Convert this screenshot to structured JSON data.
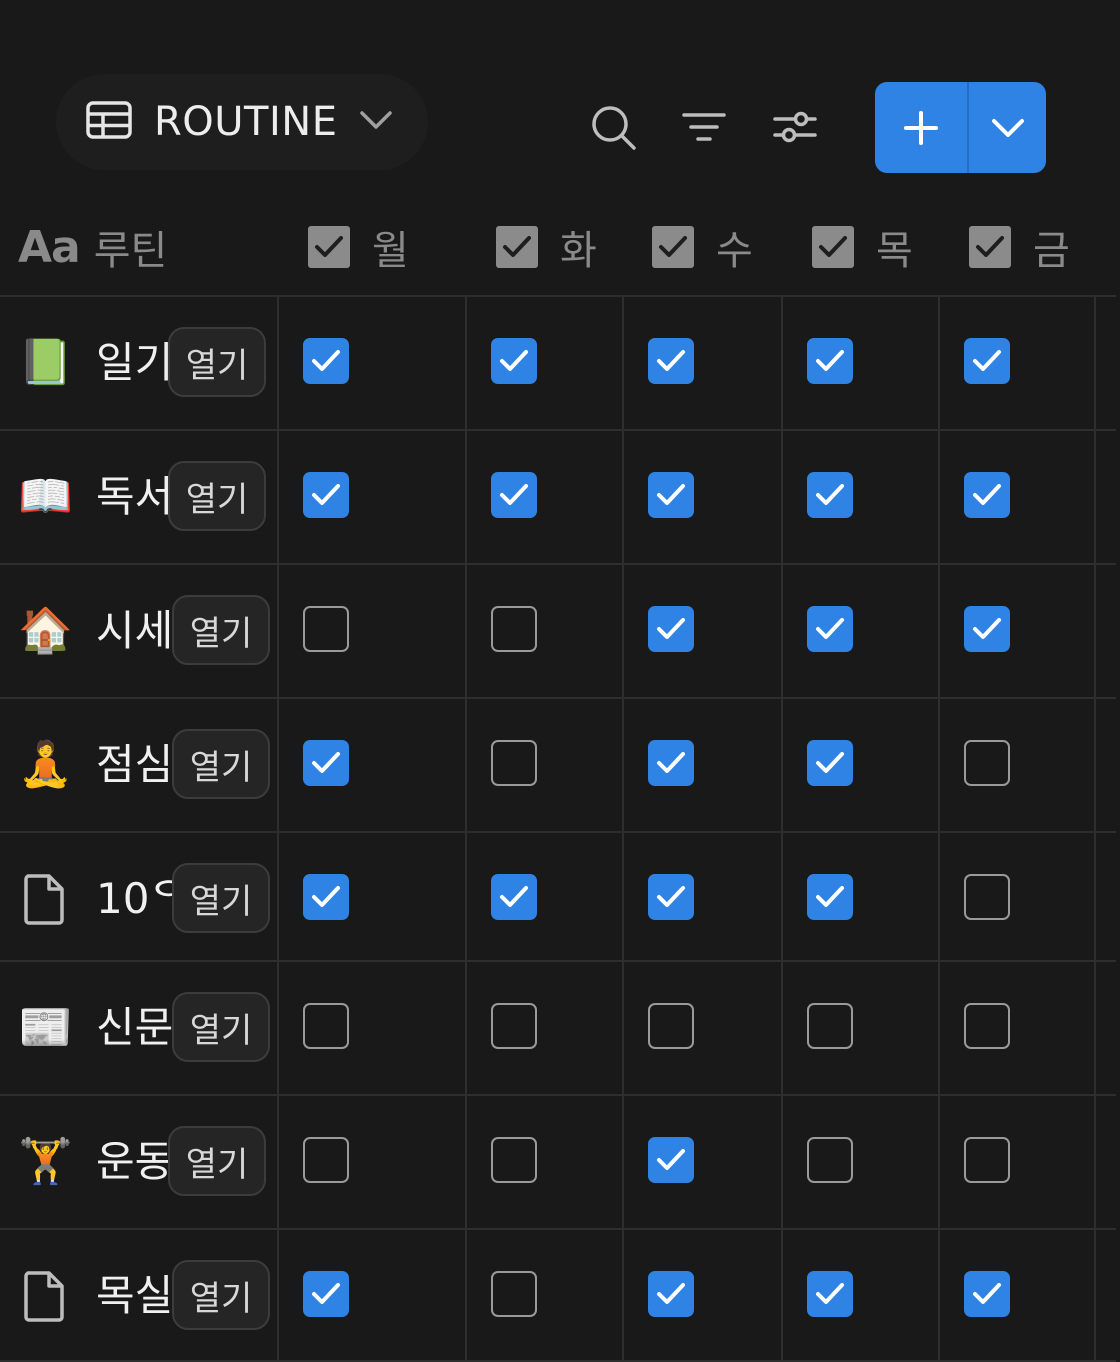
{
  "view": {
    "name": "ROUTINE"
  },
  "columns": {
    "title_header": "루틴",
    "title_icon_text": "Aa",
    "days": [
      "월",
      "화",
      "수",
      "목",
      "금"
    ]
  },
  "open_label": "열기",
  "rows": [
    {
      "emoji": "📗",
      "name": "일기",
      "checks": [
        true,
        true,
        true,
        true,
        true
      ]
    },
    {
      "emoji": "📖",
      "name": "독서",
      "checks": [
        true,
        true,
        true,
        true,
        true
      ]
    },
    {
      "emoji": "🏠",
      "name": "시세",
      "checks": [
        false,
        false,
        true,
        true,
        true
      ]
    },
    {
      "emoji": "🧘",
      "name": "점심",
      "checks": [
        true,
        false,
        true,
        true,
        false
      ]
    },
    {
      "emoji": "page-icon",
      "name": "10ᄋ",
      "checks": [
        true,
        true,
        true,
        true,
        false
      ]
    },
    {
      "emoji": "📰",
      "name": "신문",
      "checks": [
        false,
        false,
        false,
        false,
        false
      ]
    },
    {
      "emoji": "🏋️",
      "name": "운동",
      "checks": [
        false,
        false,
        true,
        false,
        false
      ]
    },
    {
      "emoji": "page-icon",
      "name": "목실",
      "checks": [
        true,
        false,
        true,
        true,
        true
      ]
    }
  ],
  "colors": {
    "accent": "#2f83e4",
    "background": "#191919"
  }
}
